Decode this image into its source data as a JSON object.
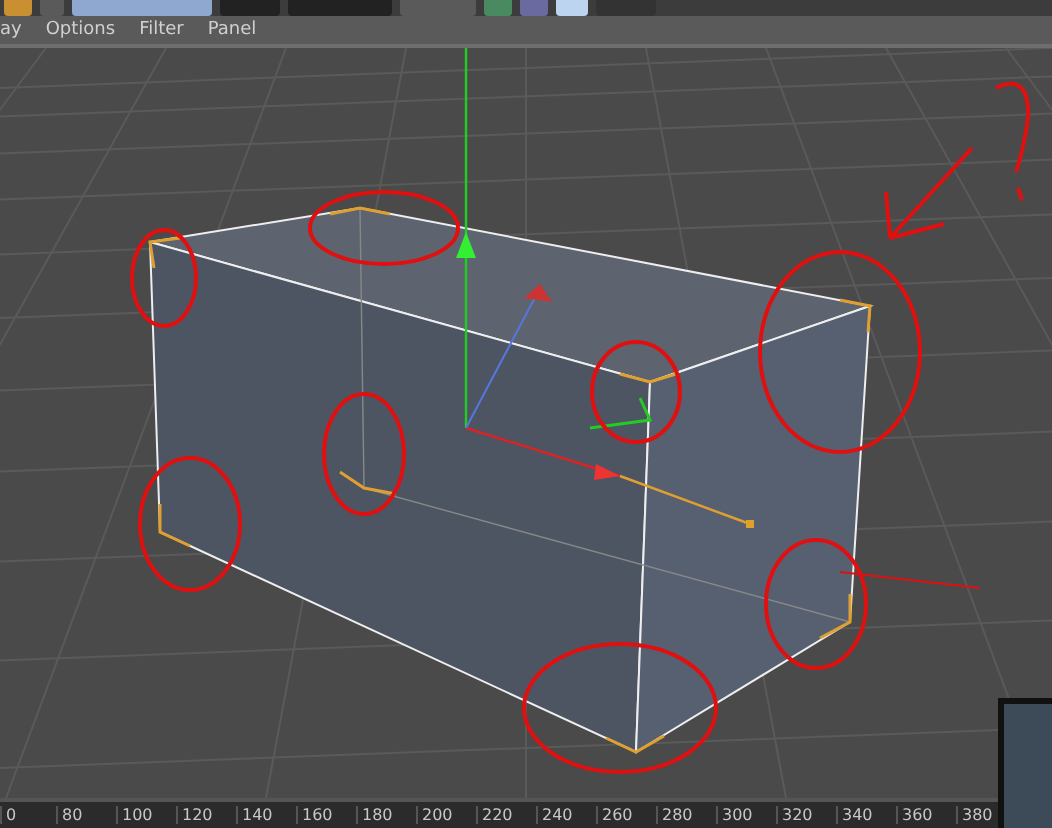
{
  "menu": [
    "ay",
    "Options",
    "Filter",
    "Panel"
  ],
  "ruler": [
    "0",
    "80",
    "100",
    "120",
    "140",
    "160",
    "180",
    "200",
    "220",
    "240",
    "260",
    "280",
    "300",
    "320",
    "340",
    "360",
    "380"
  ]
}
